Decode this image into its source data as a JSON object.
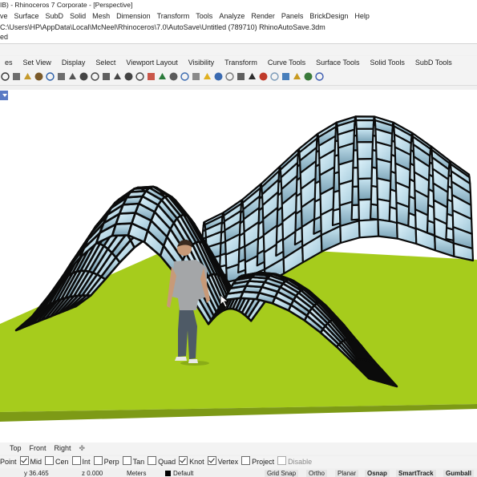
{
  "window": {
    "title": "IB) - Rhinoceros 7 Corporate - [Perspective]"
  },
  "menu": {
    "items": [
      "ve",
      "Surface",
      "SubD",
      "Solid",
      "Mesh",
      "Dimension",
      "Transform",
      "Tools",
      "Analyze",
      "Render",
      "Panels",
      "BrickDesign",
      "Help"
    ]
  },
  "command": {
    "line1": "C:\\Users\\HP\\AppData\\Local\\McNeel\\Rhinoceros\\7.0\\AutoSave\\Untitled (789710) RhinoAutoSave.3dm",
    "line2": "ed"
  },
  "toolbar_tabs": [
    "es",
    "Set View",
    "Display",
    "Select",
    "Viewport Layout",
    "Visibility",
    "Transform",
    "Curve Tools",
    "Surface Tools",
    "Solid Tools",
    "SubD Tools"
  ],
  "toolbar_icons": [
    "close-icon",
    "cut-icon",
    "copy-icon",
    "paste-icon",
    "undo-icon",
    "pan-hand-icon",
    "rotate-view-icon",
    "zoom-icon",
    "zoom-window-icon",
    "zoom-extents-icon",
    "zoom-selected-icon",
    "named-view-icon",
    "camera-icon",
    "car-icon",
    "set-cplane-icon",
    "osnap-icon",
    "4-view-icon",
    "grid-icon",
    "light-icon",
    "layer-icon",
    "properties-icon",
    "shade-icon",
    "render-icon",
    "material-icon",
    "sphere-icon",
    "globe-icon",
    "options-icon",
    "display-mode-icon",
    "help-icon"
  ],
  "view_tabs": [
    "Top",
    "Front",
    "Right"
  ],
  "osnaps": [
    {
      "label": "Point",
      "checked": false
    },
    {
      "label": "Mid",
      "checked": true
    },
    {
      "label": "Cen",
      "checked": false
    },
    {
      "label": "Int",
      "checked": false
    },
    {
      "label": "Perp",
      "checked": false
    },
    {
      "label": "Tan",
      "checked": false
    },
    {
      "label": "Quad",
      "checked": false
    },
    {
      "label": "Knot",
      "checked": true
    },
    {
      "label": "Vertex",
      "checked": true
    },
    {
      "label": "Project",
      "checked": false
    },
    {
      "label": "Disable",
      "checked": false
    }
  ],
  "status": {
    "y": "y 36.465",
    "z": "z 0.000",
    "units": "Meters",
    "layer": "Default",
    "grid_snap": "Grid Snap",
    "ortho": "Ortho",
    "planar": "Planar",
    "osnap": "Osnap",
    "smarttrack": "SmartTrack",
    "gumball": "Gumball"
  },
  "colors": {
    "ground": "#a6cc1c",
    "ground_edge": "#7d9a16",
    "sky": "#ffffff",
    "panel": "#f3f3f3",
    "viewport_marker": "#5a7ac4"
  }
}
